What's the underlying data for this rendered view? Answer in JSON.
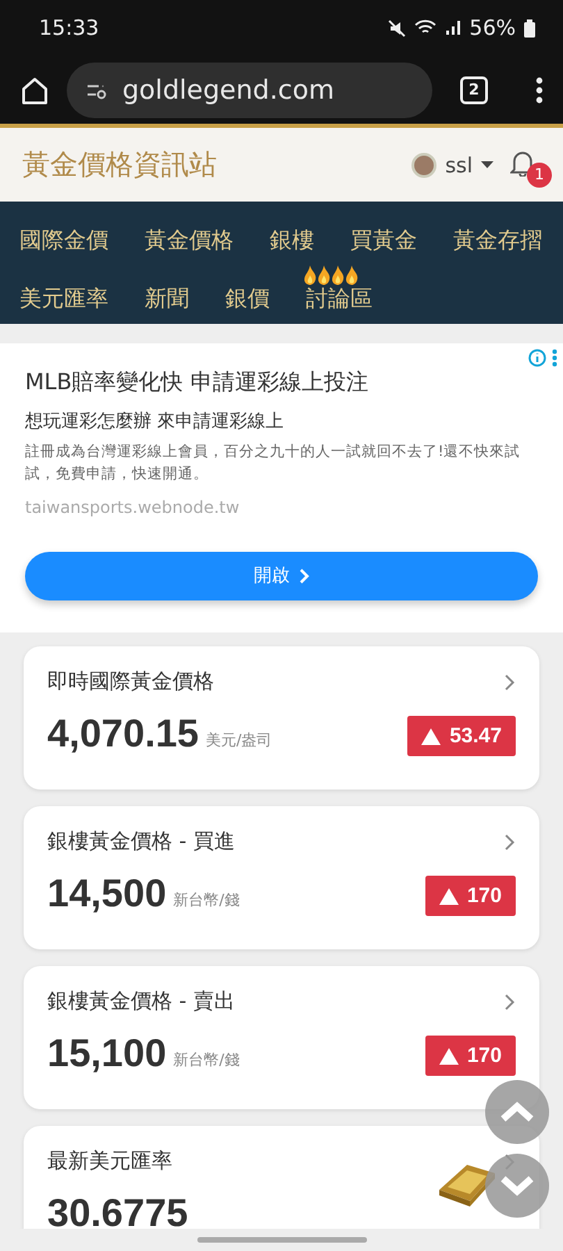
{
  "status_bar": {
    "time": "15:33",
    "battery": "56%"
  },
  "browser": {
    "url": "goldlegend.com",
    "tab_count": "2"
  },
  "header": {
    "title": "黃金價格資訊站",
    "user": "ssl",
    "notifications": "1"
  },
  "nav": [
    {
      "label": "國際金價",
      "hot": false
    },
    {
      "label": "黃金價格",
      "hot": false
    },
    {
      "label": "銀樓",
      "hot": false
    },
    {
      "label": "買黃金",
      "hot": false
    },
    {
      "label": "黃金存摺",
      "hot": false
    },
    {
      "label": "美元匯率",
      "hot": false
    },
    {
      "label": "新聞",
      "hot": false
    },
    {
      "label": "銀價",
      "hot": false
    },
    {
      "label": "討論區",
      "hot": true
    }
  ],
  "ad": {
    "headline": "MLB賠率變化快 申請運彩線上投注",
    "subhead": "想玩運彩怎麼辦 來申請運彩線上",
    "body": "註冊成為台灣運彩線上會員，百分之九十的人一試就回不去了!還不快來試試，免費申請，快速開通。",
    "domain": "taiwansports.webnode.tw",
    "button": "開啟"
  },
  "cards": [
    {
      "title": "即時國際黃金價格",
      "value": "4,070.15",
      "unit": "美元/盎司",
      "change": "53.47",
      "up": true
    },
    {
      "title": "銀樓黃金價格 - 買進",
      "value": "14,500",
      "unit": "新台幣/錢",
      "change": "170",
      "up": true
    },
    {
      "title": "銀樓黃金價格 - 賣出",
      "value": "15,100",
      "unit": "新台幣/錢",
      "change": "170",
      "up": true
    },
    {
      "title": "最新美元匯率",
      "value": "30.6775",
      "kind": "picture"
    }
  ]
}
